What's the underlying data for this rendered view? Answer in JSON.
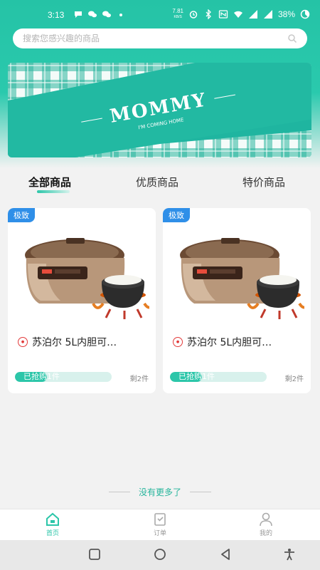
{
  "status_bar": {
    "time": "3:13",
    "net_speed_value": "7.81",
    "net_speed_unit": "KB/S",
    "battery": "38%",
    "icons": [
      "chat-bubble-icon",
      "wechat-icon",
      "wechat-icon",
      "dot-icon",
      "alarm-icon",
      "bluetooth-icon",
      "nfc-icon",
      "wifi-icon",
      "signal-icon",
      "battery-icon"
    ]
  },
  "search": {
    "placeholder": "搜索您感兴趣的商品"
  },
  "banner": {
    "headline": "MOMMY",
    "subline": "I'M COMING HOME"
  },
  "tabs": [
    {
      "label": "全部商品",
      "active": true
    },
    {
      "label": "优质商品",
      "active": false
    },
    {
      "label": "特价商品",
      "active": false
    }
  ],
  "products": [
    {
      "badge": "极致",
      "title": "苏泊尔 5L内胆可…",
      "progress_label": "已抢购1件",
      "progress_fraction": 0.33,
      "remaining": "剩2件"
    },
    {
      "badge": "极致",
      "title": "苏泊尔 5L内胆可…",
      "progress_label": "已抢购1件",
      "progress_fraction": 0.33,
      "remaining": "剩2件"
    }
  ],
  "footer_note": "没有更多了",
  "bottom_nav": [
    {
      "label": "首页",
      "icon": "home-icon",
      "active": true
    },
    {
      "label": "订单",
      "icon": "order-icon",
      "active": false
    },
    {
      "label": "我的",
      "icon": "profile-icon",
      "active": false
    }
  ],
  "colors": {
    "accent": "#2cc6a9",
    "badge": "#2f8fe8",
    "shop_logo": "#e23a3a"
  }
}
